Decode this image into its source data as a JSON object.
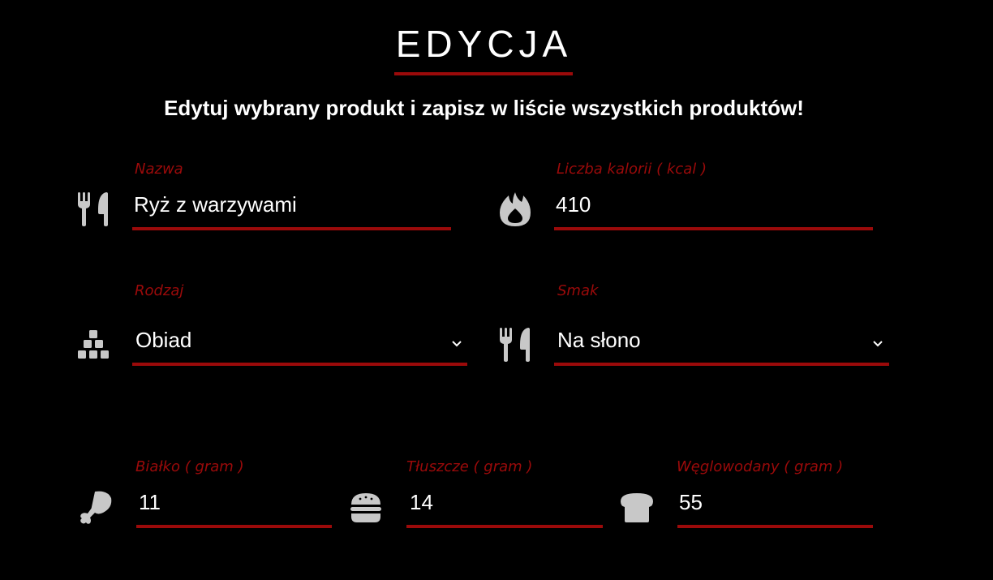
{
  "page": {
    "title": "EDYCJA",
    "subtitle": "Edytuj wybrany produkt i zapisz w liście wszystkich produktów!"
  },
  "colors": {
    "background": "#000000",
    "accent": "#9b0a0a",
    "text": "#ffffff",
    "icon": "#c8c8c8"
  },
  "form": {
    "name": {
      "label": "Nazwa",
      "value": "Ryż z warzywami",
      "icon": "utensils-icon"
    },
    "calories": {
      "label": "Liczba kalorii ( kcal )",
      "value": "410",
      "icon": "fire-icon"
    },
    "type": {
      "label": "Rodzaj",
      "value": "Obiad",
      "icon": "cubes-icon"
    },
    "taste": {
      "label": "Smak",
      "value": "Na słono",
      "icon": "utensils-icon"
    },
    "protein": {
      "label": "Białko ( gram )",
      "value": "11",
      "icon": "drumstick-icon"
    },
    "fat": {
      "label": "Tłuszcze ( gram )",
      "value": "14",
      "icon": "hamburger-icon"
    },
    "carbs": {
      "label": "Węglowodany ( gram )",
      "value": "55",
      "icon": "bread-icon"
    }
  }
}
